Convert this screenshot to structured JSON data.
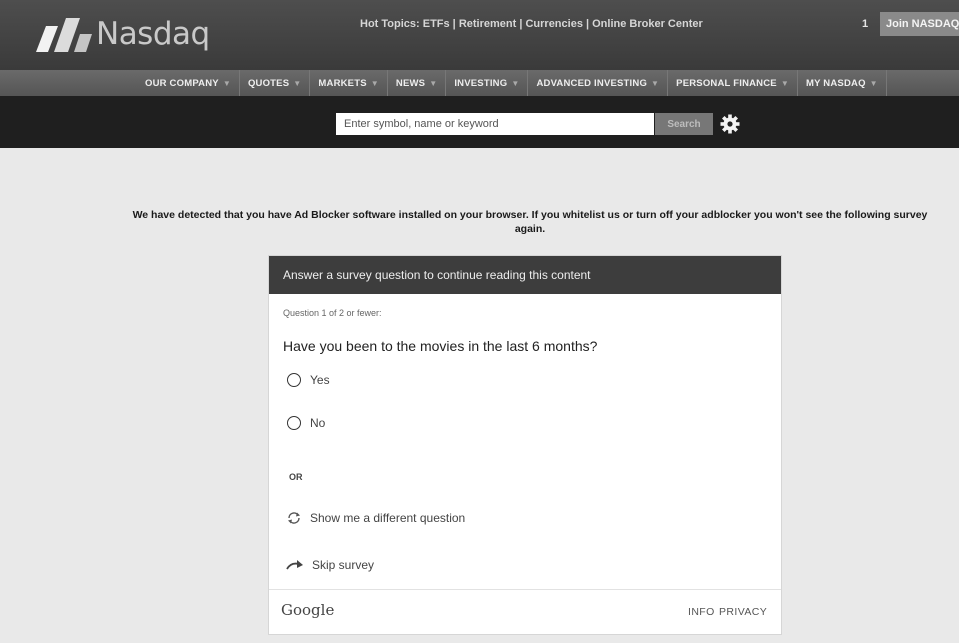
{
  "header": {
    "logo_text": "Nasdaq",
    "hot_topics": "Hot Topics: ETFs | Retirement | Currencies | Online Broker Center",
    "notification_count": "1",
    "join_label": "Join NASDAQ"
  },
  "nav": {
    "items": [
      {
        "label": "OUR COMPANY"
      },
      {
        "label": "QUOTES"
      },
      {
        "label": "MARKETS"
      },
      {
        "label": "NEWS"
      },
      {
        "label": "INVESTING"
      },
      {
        "label": "ADVANCED INVESTING"
      },
      {
        "label": "PERSONAL FINANCE"
      },
      {
        "label": "MY NASDAQ"
      }
    ],
    "caret_icon": "chevron-down-icon"
  },
  "search": {
    "placeholder": "Enter symbol, name or keyword",
    "button_label": "Search",
    "settings_icon": "gear-icon"
  },
  "adblock_message": "We have detected that you have Ad Blocker software installed on your browser. If you whitelist us or turn off your adblocker you won't see the following survey again.",
  "survey": {
    "header": "Answer a survey question to continue reading this content",
    "question_count": "Question 1 of 2 or fewer:",
    "question": "Have you been to the movies in the last 6 months?",
    "options": [
      {
        "label": "Yes"
      },
      {
        "label": "No"
      }
    ],
    "or_label": "OR",
    "different_question": "Show me a different question",
    "skip": "Skip survey",
    "footer": {
      "brand": "Google",
      "info_label": "INFO",
      "privacy_label": "PRIVACY"
    }
  },
  "colors": {
    "topbar": "#3f3f3f",
    "navbar": "#5e5e5e",
    "searchbar": "#1f1f1f",
    "survey_header": "#3d3d3d"
  }
}
